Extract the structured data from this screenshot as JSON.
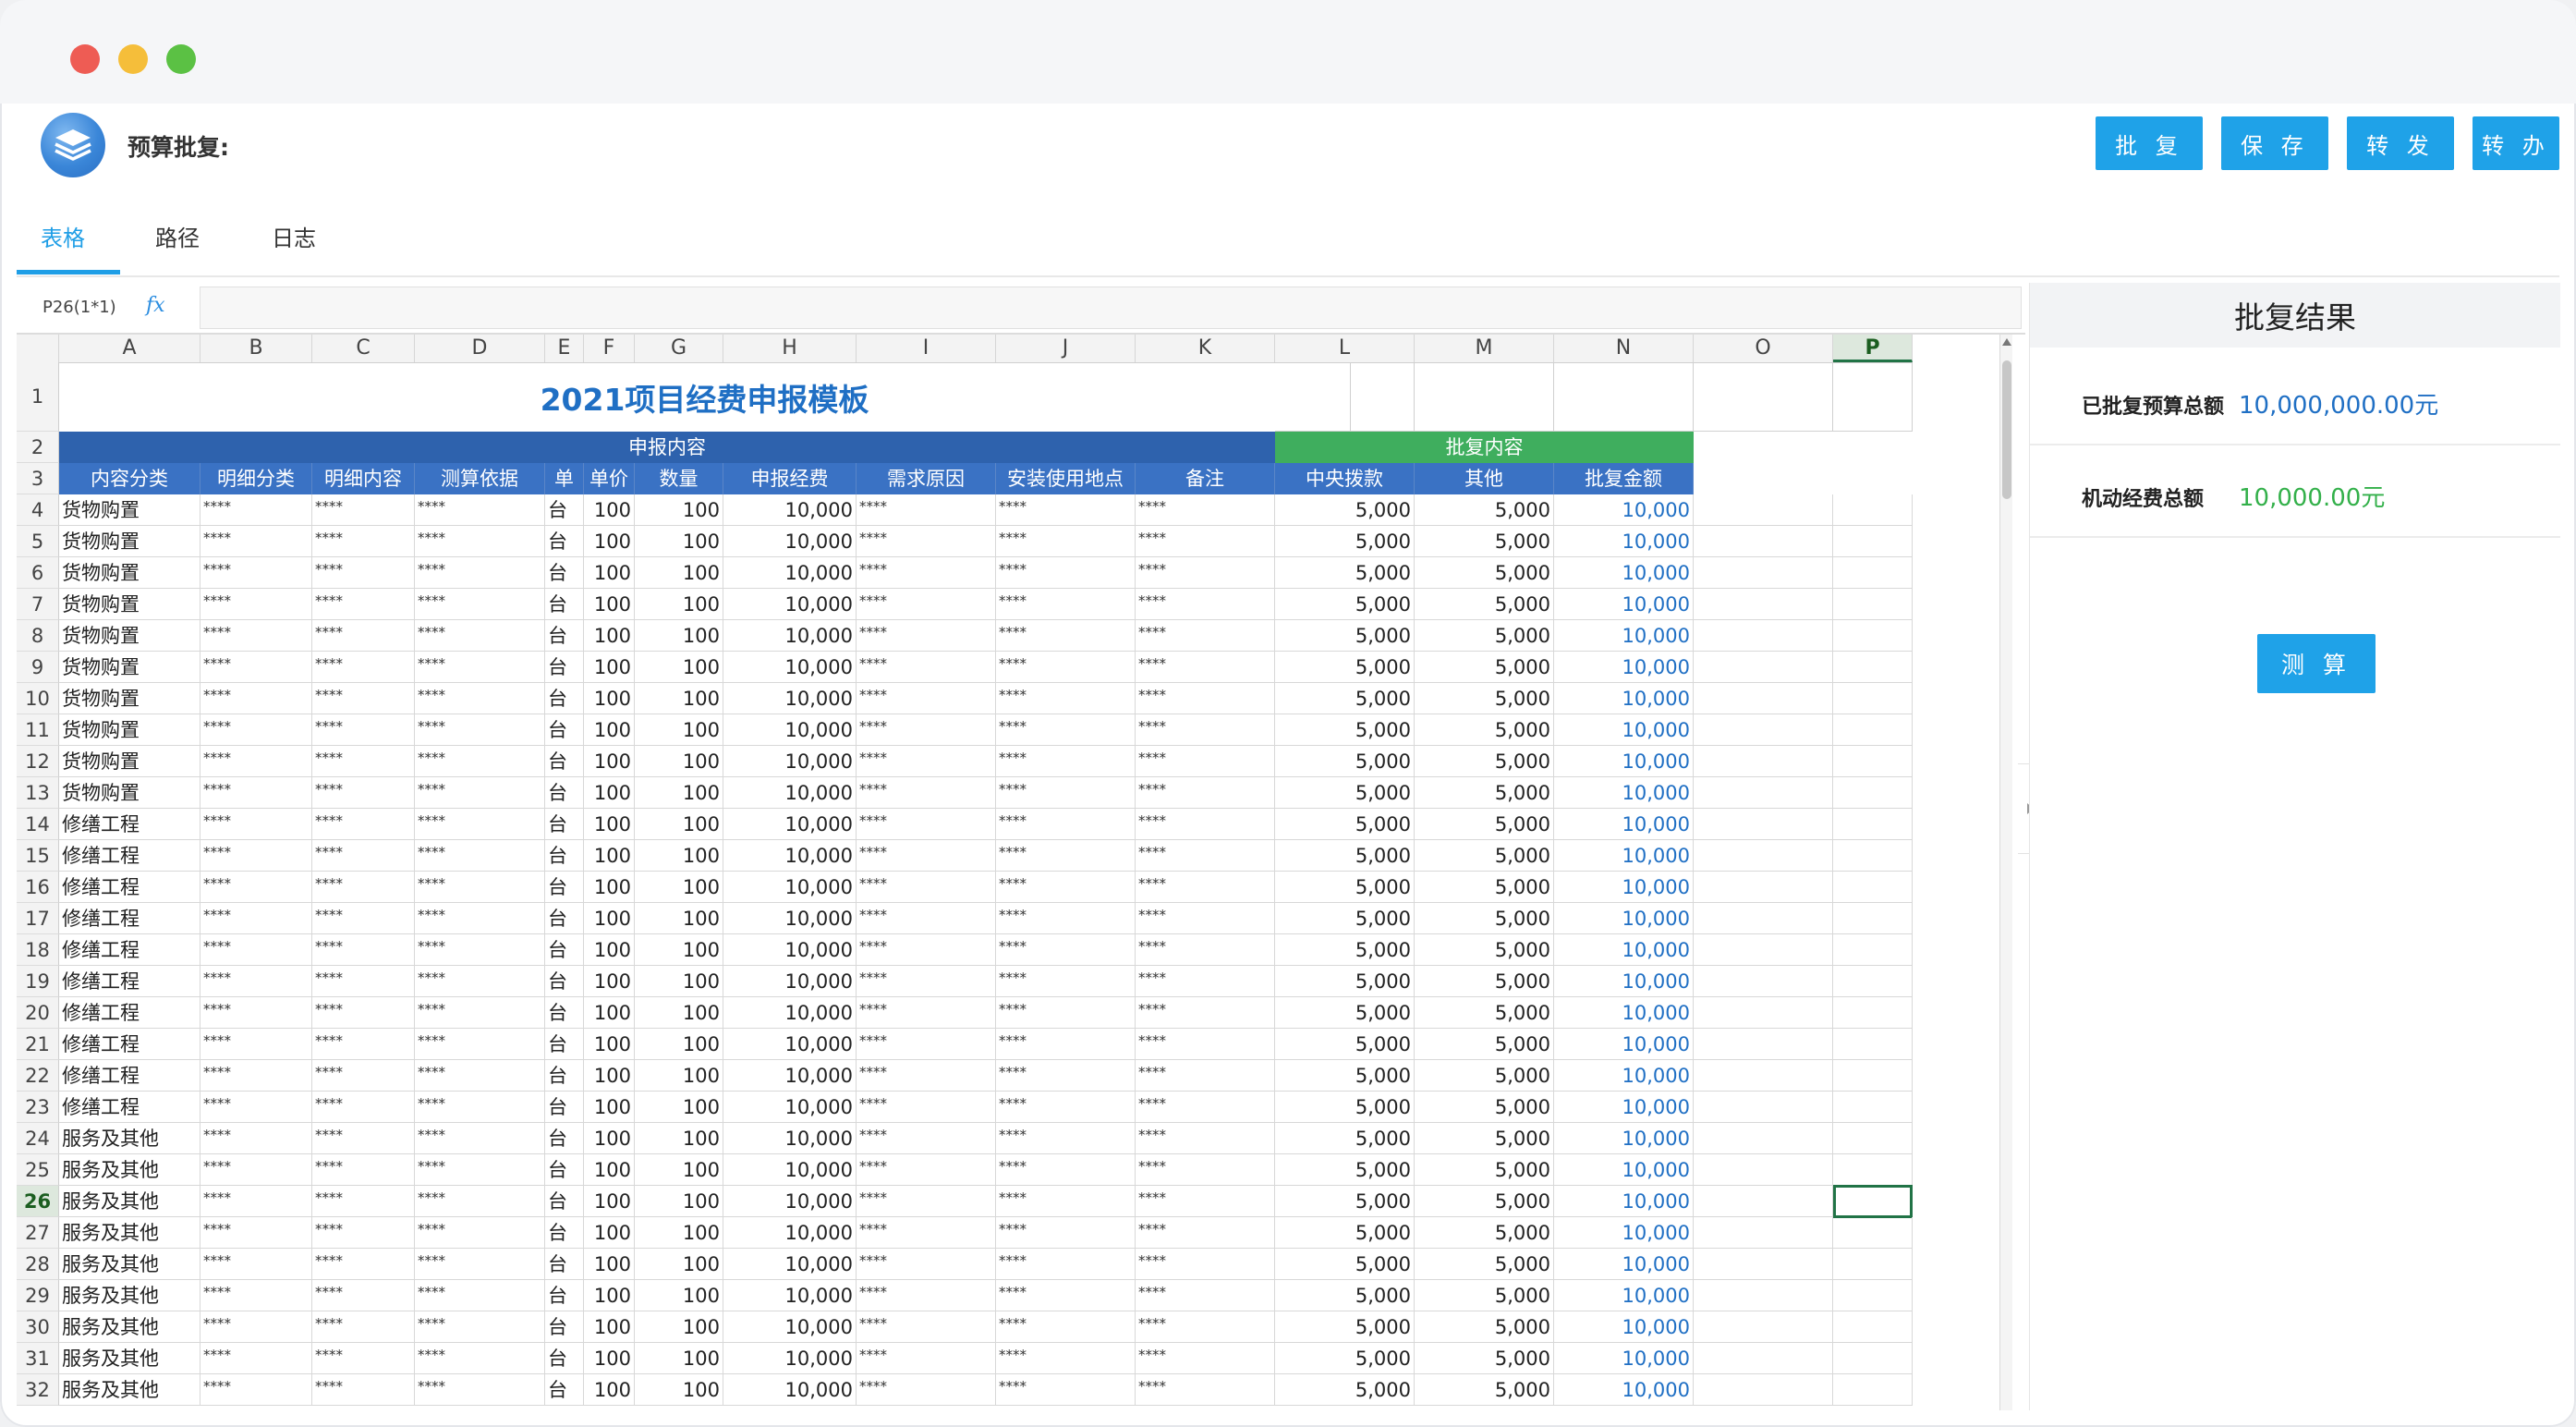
{
  "app": {
    "title": "预算批复:"
  },
  "header_buttons": [
    "批 复",
    "保 存",
    "转 发",
    "转 办"
  ],
  "tabs": [
    {
      "label": "表格",
      "active": true
    },
    {
      "label": "路径",
      "active": false
    },
    {
      "label": "日志",
      "active": false
    }
  ],
  "formula_bar": {
    "cell_ref": "P26(1*1)",
    "fx": "fx",
    "content": ""
  },
  "sheet": {
    "columns": [
      "A",
      "B",
      "C",
      "D",
      "E",
      "F",
      "G",
      "H",
      "I",
      "J",
      "K",
      "L",
      "M",
      "N",
      "O",
      "P"
    ],
    "selected_column": "P",
    "selected_row": "26",
    "title": "2021项目经费申报模板",
    "group_apply": "申报内容",
    "group_approve": "批复内容",
    "headers": [
      "内容分类",
      "明细分类",
      "明细内容",
      "测算依据",
      "单位",
      "单价",
      "数量",
      "申报经费",
      "需求原因",
      "安装使用地点",
      "备注",
      "中央拨款",
      "其他",
      "批复金额"
    ],
    "data_rows": [
      {
        "row": "4",
        "cat": "货物购置",
        "b": "****",
        "c": "****",
        "d": "****",
        "unit": "台",
        "price": "100",
        "qty": "100",
        "apply": "10,000",
        "i": "****",
        "j": "****",
        "k": "****",
        "central": "5,000",
        "other": "5,000",
        "total": "10,000"
      },
      {
        "row": "5",
        "cat": "货物购置",
        "b": "****",
        "c": "****",
        "d": "****",
        "unit": "台",
        "price": "100",
        "qty": "100",
        "apply": "10,000",
        "i": "****",
        "j": "****",
        "k": "****",
        "central": "5,000",
        "other": "5,000",
        "total": "10,000"
      },
      {
        "row": "6",
        "cat": "货物购置",
        "b": "****",
        "c": "****",
        "d": "****",
        "unit": "台",
        "price": "100",
        "qty": "100",
        "apply": "10,000",
        "i": "****",
        "j": "****",
        "k": "****",
        "central": "5,000",
        "other": "5,000",
        "total": "10,000"
      },
      {
        "row": "7",
        "cat": "货物购置",
        "b": "****",
        "c": "****",
        "d": "****",
        "unit": "台",
        "price": "100",
        "qty": "100",
        "apply": "10,000",
        "i": "****",
        "j": "****",
        "k": "****",
        "central": "5,000",
        "other": "5,000",
        "total": "10,000"
      },
      {
        "row": "8",
        "cat": "货物购置",
        "b": "****",
        "c": "****",
        "d": "****",
        "unit": "台",
        "price": "100",
        "qty": "100",
        "apply": "10,000",
        "i": "****",
        "j": "****",
        "k": "****",
        "central": "5,000",
        "other": "5,000",
        "total": "10,000"
      },
      {
        "row": "9",
        "cat": "货物购置",
        "b": "****",
        "c": "****",
        "d": "****",
        "unit": "台",
        "price": "100",
        "qty": "100",
        "apply": "10,000",
        "i": "****",
        "j": "****",
        "k": "****",
        "central": "5,000",
        "other": "5,000",
        "total": "10,000"
      },
      {
        "row": "10",
        "cat": "货物购置",
        "b": "****",
        "c": "****",
        "d": "****",
        "unit": "台",
        "price": "100",
        "qty": "100",
        "apply": "10,000",
        "i": "****",
        "j": "****",
        "k": "****",
        "central": "5,000",
        "other": "5,000",
        "total": "10,000"
      },
      {
        "row": "11",
        "cat": "货物购置",
        "b": "****",
        "c": "****",
        "d": "****",
        "unit": "台",
        "price": "100",
        "qty": "100",
        "apply": "10,000",
        "i": "****",
        "j": "****",
        "k": "****",
        "central": "5,000",
        "other": "5,000",
        "total": "10,000"
      },
      {
        "row": "12",
        "cat": "货物购置",
        "b": "****",
        "c": "****",
        "d": "****",
        "unit": "台",
        "price": "100",
        "qty": "100",
        "apply": "10,000",
        "i": "****",
        "j": "****",
        "k": "****",
        "central": "5,000",
        "other": "5,000",
        "total": "10,000"
      },
      {
        "row": "13",
        "cat": "货物购置",
        "b": "****",
        "c": "****",
        "d": "****",
        "unit": "台",
        "price": "100",
        "qty": "100",
        "apply": "10,000",
        "i": "****",
        "j": "****",
        "k": "****",
        "central": "5,000",
        "other": "5,000",
        "total": "10,000"
      },
      {
        "row": "14",
        "cat": "修缮工程",
        "b": "****",
        "c": "****",
        "d": "****",
        "unit": "台",
        "price": "100",
        "qty": "100",
        "apply": "10,000",
        "i": "****",
        "j": "****",
        "k": "****",
        "central": "5,000",
        "other": "5,000",
        "total": "10,000"
      },
      {
        "row": "15",
        "cat": "修缮工程",
        "b": "****",
        "c": "****",
        "d": "****",
        "unit": "台",
        "price": "100",
        "qty": "100",
        "apply": "10,000",
        "i": "****",
        "j": "****",
        "k": "****",
        "central": "5,000",
        "other": "5,000",
        "total": "10,000"
      },
      {
        "row": "16",
        "cat": "修缮工程",
        "b": "****",
        "c": "****",
        "d": "****",
        "unit": "台",
        "price": "100",
        "qty": "100",
        "apply": "10,000",
        "i": "****",
        "j": "****",
        "k": "****",
        "central": "5,000",
        "other": "5,000",
        "total": "10,000"
      },
      {
        "row": "17",
        "cat": "修缮工程",
        "b": "****",
        "c": "****",
        "d": "****",
        "unit": "台",
        "price": "100",
        "qty": "100",
        "apply": "10,000",
        "i": "****",
        "j": "****",
        "k": "****",
        "central": "5,000",
        "other": "5,000",
        "total": "10,000"
      },
      {
        "row": "18",
        "cat": "修缮工程",
        "b": "****",
        "c": "****",
        "d": "****",
        "unit": "台",
        "price": "100",
        "qty": "100",
        "apply": "10,000",
        "i": "****",
        "j": "****",
        "k": "****",
        "central": "5,000",
        "other": "5,000",
        "total": "10,000"
      },
      {
        "row": "19",
        "cat": "修缮工程",
        "b": "****",
        "c": "****",
        "d": "****",
        "unit": "台",
        "price": "100",
        "qty": "100",
        "apply": "10,000",
        "i": "****",
        "j": "****",
        "k": "****",
        "central": "5,000",
        "other": "5,000",
        "total": "10,000"
      },
      {
        "row": "20",
        "cat": "修缮工程",
        "b": "****",
        "c": "****",
        "d": "****",
        "unit": "台",
        "price": "100",
        "qty": "100",
        "apply": "10,000",
        "i": "****",
        "j": "****",
        "k": "****",
        "central": "5,000",
        "other": "5,000",
        "total": "10,000"
      },
      {
        "row": "21",
        "cat": "修缮工程",
        "b": "****",
        "c": "****",
        "d": "****",
        "unit": "台",
        "price": "100",
        "qty": "100",
        "apply": "10,000",
        "i": "****",
        "j": "****",
        "k": "****",
        "central": "5,000",
        "other": "5,000",
        "total": "10,000"
      },
      {
        "row": "22",
        "cat": "修缮工程",
        "b": "****",
        "c": "****",
        "d": "****",
        "unit": "台",
        "price": "100",
        "qty": "100",
        "apply": "10,000",
        "i": "****",
        "j": "****",
        "k": "****",
        "central": "5,000",
        "other": "5,000",
        "total": "10,000"
      },
      {
        "row": "23",
        "cat": "修缮工程",
        "b": "****",
        "c": "****",
        "d": "****",
        "unit": "台",
        "price": "100",
        "qty": "100",
        "apply": "10,000",
        "i": "****",
        "j": "****",
        "k": "****",
        "central": "5,000",
        "other": "5,000",
        "total": "10,000"
      },
      {
        "row": "24",
        "cat": "服务及其他",
        "b": "****",
        "c": "****",
        "d": "****",
        "unit": "台",
        "price": "100",
        "qty": "100",
        "apply": "10,000",
        "i": "****",
        "j": "****",
        "k": "****",
        "central": "5,000",
        "other": "5,000",
        "total": "10,000"
      },
      {
        "row": "25",
        "cat": "服务及其他",
        "b": "****",
        "c": "****",
        "d": "****",
        "unit": "台",
        "price": "100",
        "qty": "100",
        "apply": "10,000",
        "i": "****",
        "j": "****",
        "k": "****",
        "central": "5,000",
        "other": "5,000",
        "total": "10,000"
      },
      {
        "row": "26",
        "cat": "服务及其他",
        "b": "****",
        "c": "****",
        "d": "****",
        "unit": "台",
        "price": "100",
        "qty": "100",
        "apply": "10,000",
        "i": "****",
        "j": "****",
        "k": "****",
        "central": "5,000",
        "other": "5,000",
        "total": "10,000"
      },
      {
        "row": "27",
        "cat": "服务及其他",
        "b": "****",
        "c": "****",
        "d": "****",
        "unit": "台",
        "price": "100",
        "qty": "100",
        "apply": "10,000",
        "i": "****",
        "j": "****",
        "k": "****",
        "central": "5,000",
        "other": "5,000",
        "total": "10,000"
      },
      {
        "row": "28",
        "cat": "服务及其他",
        "b": "****",
        "c": "****",
        "d": "****",
        "unit": "台",
        "price": "100",
        "qty": "100",
        "apply": "10,000",
        "i": "****",
        "j": "****",
        "k": "****",
        "central": "5,000",
        "other": "5,000",
        "total": "10,000"
      },
      {
        "row": "29",
        "cat": "服务及其他",
        "b": "****",
        "c": "****",
        "d": "****",
        "unit": "台",
        "price": "100",
        "qty": "100",
        "apply": "10,000",
        "i": "****",
        "j": "****",
        "k": "****",
        "central": "5,000",
        "other": "5,000",
        "total": "10,000"
      },
      {
        "row": "30",
        "cat": "服务及其他",
        "b": "****",
        "c": "****",
        "d": "****",
        "unit": "台",
        "price": "100",
        "qty": "100",
        "apply": "10,000",
        "i": "****",
        "j": "****",
        "k": "****",
        "central": "5,000",
        "other": "5,000",
        "total": "10,000"
      },
      {
        "row": "31",
        "cat": "服务及其他",
        "b": "****",
        "c": "****",
        "d": "****",
        "unit": "台",
        "price": "100",
        "qty": "100",
        "apply": "10,000",
        "i": "****",
        "j": "****",
        "k": "****",
        "central": "5,000",
        "other": "5,000",
        "total": "10,000"
      },
      {
        "row": "32",
        "cat": "服务及其他",
        "b": "****",
        "c": "****",
        "d": "****",
        "unit": "台",
        "price": "100",
        "qty": "100",
        "apply": "10,000",
        "i": "****",
        "j": "****",
        "k": "****",
        "central": "5,000",
        "other": "5,000",
        "total": "10,000"
      }
    ]
  },
  "result_panel": {
    "title": "批复结果",
    "approved_label": "已批复预算总额",
    "approved_value": "10,000,000.00元",
    "flex_label": "机动经费总额",
    "flex_value": "10,000.00元",
    "calc_button": "测 算"
  },
  "colors": {
    "accent": "#1fa2e8",
    "header_blue": "#2e62ad",
    "header_green": "#3fae5e",
    "amount_blue": "#1f6fc4",
    "value_green": "#33b04a"
  }
}
